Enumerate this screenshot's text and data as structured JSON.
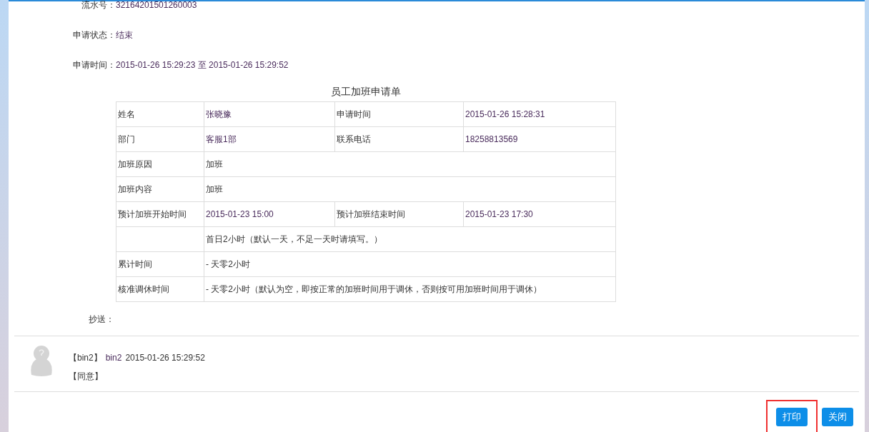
{
  "fields": [
    {
      "label": "流水号：",
      "value": "32164201501260003"
    },
    {
      "label": "申请状态：",
      "value": "结束"
    },
    {
      "label": "申请时间：",
      "value": "2015-01-26 15:29:23 至 2015-01-26 15:29:52"
    }
  ],
  "form": {
    "title": "员工加班申请单",
    "rows": [
      {
        "label": "姓名",
        "value": "张晓豫",
        "label_2": "申请时间",
        "value_2": "2015-01-26 15:28:31"
      },
      {
        "label": "部门",
        "value": "客服1部",
        "label_2": "联系电话",
        "value_2": "18258813569"
      },
      {
        "label": "加班原因",
        "value": "加班"
      },
      {
        "label": "加班内容",
        "value": "加班"
      },
      {
        "label": "预计加班开始时间",
        "value": "2015-01-23 15:00",
        "label_2": "预计加班结束时间",
        "value_2": "2015-01-23 17:30"
      },
      {
        "value": "首日2小时（默认一天，不足一天时请填写。）"
      },
      {
        "label": "累计时间",
        "value": "- 天零2小时"
      },
      {
        "label": "核准调休时间",
        "value": "- 天零2小时（默认为空，即按正常的加班时间用于调休，否则按可用加班时间用于调休）"
      }
    ]
  },
  "cc": {
    "label": "抄送："
  },
  "comments": [
    {
      "author": "【bin2】",
      "name": "bin2",
      "time": "2015-01-26 15:29:52",
      "opinion": "【同意】"
    }
  ],
  "buttons": [
    {
      "label": "打印",
      "highlighted": true
    },
    {
      "label": "关闭",
      "highlighted": false
    }
  ]
}
